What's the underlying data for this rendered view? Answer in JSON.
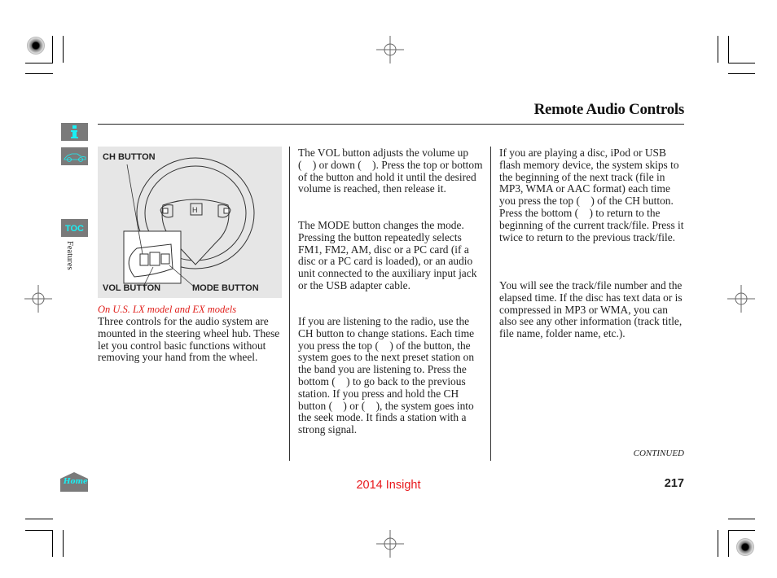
{
  "header": {
    "title": "Remote Audio Controls"
  },
  "sidebar": {
    "info_icon": "info-icon",
    "car_icon": "car-icon",
    "toc_label": "TOC",
    "section_label": "Features",
    "home_label": "Home"
  },
  "figure": {
    "labels": {
      "ch_button": "CH BUTTON",
      "vol_button": "VOL BUTTON",
      "mode_button": "MODE BUTTON"
    },
    "caption": "On U.S. LX model and EX models"
  },
  "columns": {
    "col1": [
      "Three controls for the audio system are mounted in the steering wheel hub. These let you control basic functions without removing your hand from the wheel."
    ],
    "col2": [
      "The VOL button adjusts the volume up (  ) or down (  ). Press the top or bottom of the button and hold it until the desired volume is reached, then release it.",
      "The MODE button changes the mode. Pressing the button repeatedly selects FM1, FM2, AM, disc or a PC card (if a disc or a PC card is loaded), or an audio unit connected to the auxiliary input jack or the USB adapter cable.",
      "If you are listening to the radio, use the CH button to change stations. Each time you press the top (  ) of the button, the system goes to the next preset station on the band you are listening to. Press the bottom (  ) to go back to the previous station. If you press and hold the CH button (  ) or (  ), the system goes into the seek mode. It finds a station with a strong signal."
    ],
    "col3": [
      "If you are playing a disc, iPod or USB flash memory device, the system skips to the beginning of the next track (file in MP3, WMA or AAC format) each time you press the top (  ) of the CH button. Press the bottom (  ) to return to the beginning of the current track/file. Press it twice to return to the previous track/file.",
      "You will see the track/file number and the elapsed time. If the disc has text data or is compressed in MP3 or WMA, you can also see any other information (track title, file name, folder name, etc.)."
    ]
  },
  "footer": {
    "continued": "CONTINUED",
    "model": "2014 Insight",
    "page_number": "217"
  },
  "colors": {
    "accent_cyan": "#19f0f4",
    "model_red": "#e8181c",
    "button_gray": "#7a7a7a"
  }
}
